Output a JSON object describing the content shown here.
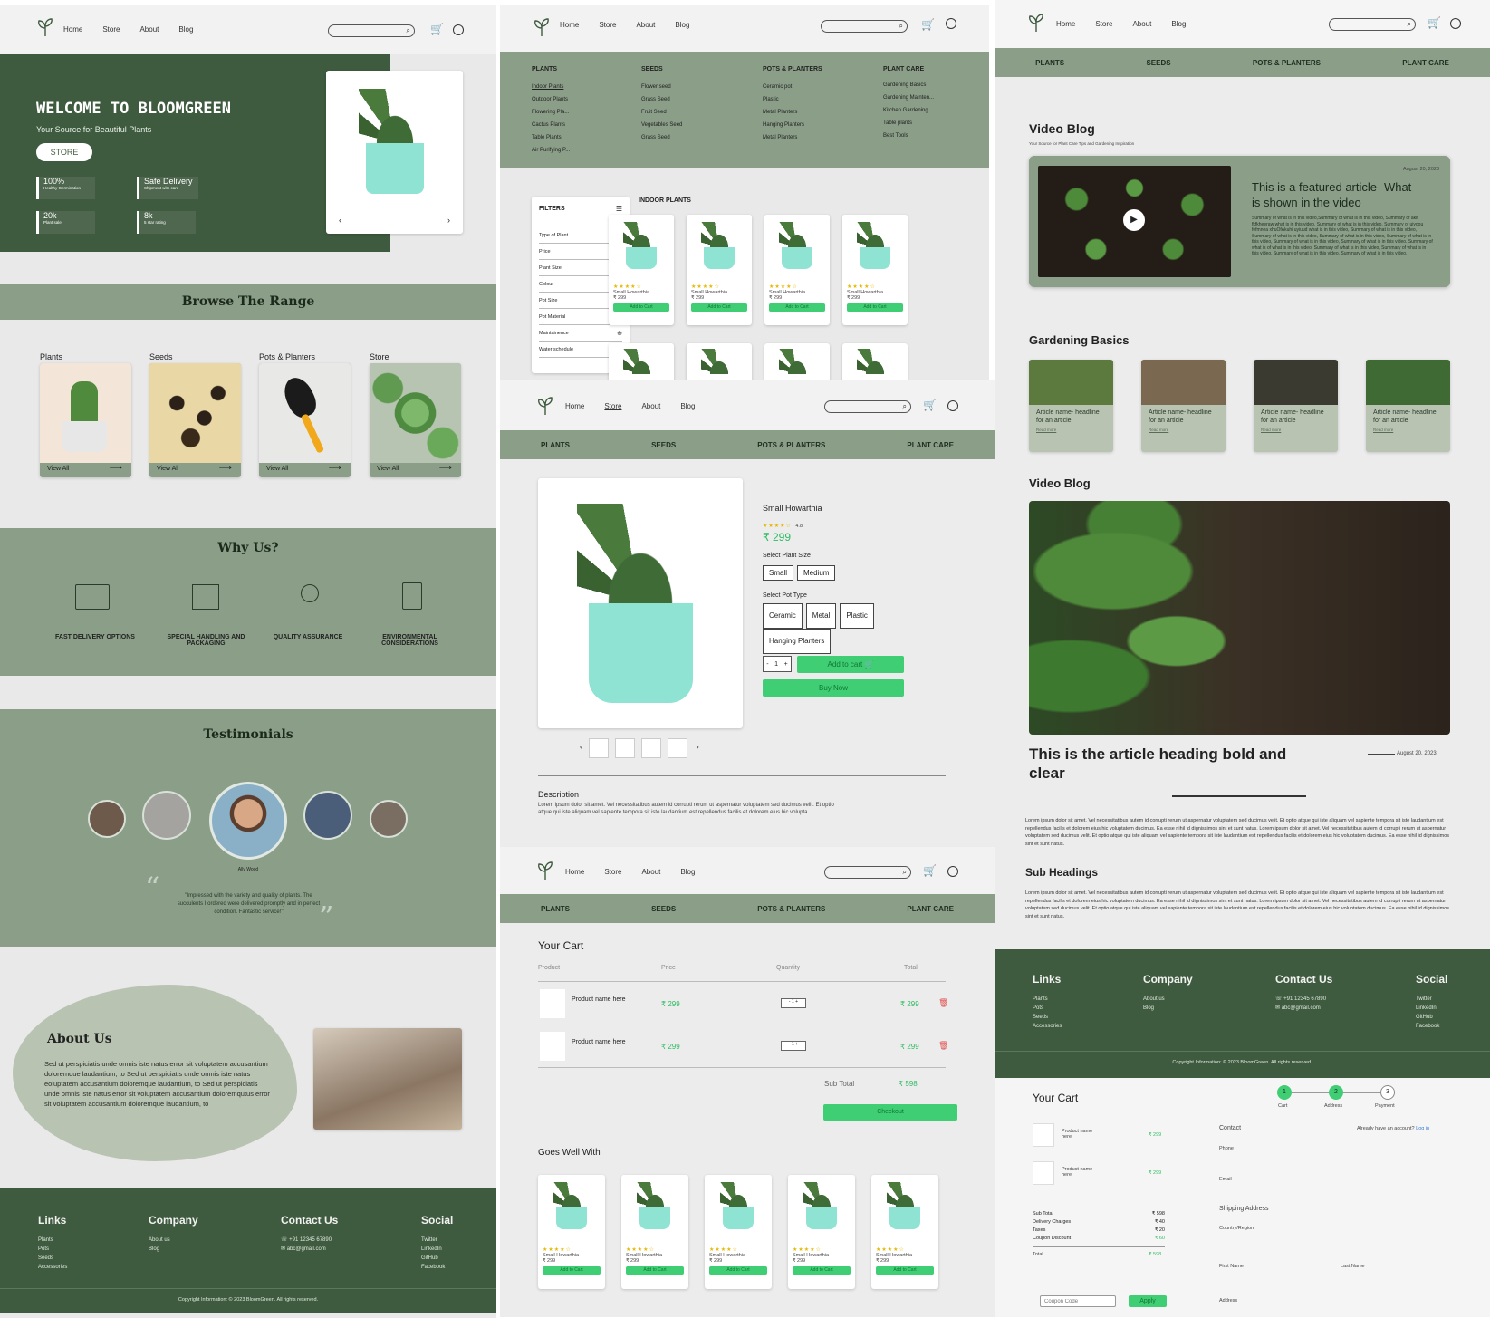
{
  "nav": {
    "home": "Home",
    "store": "Store",
    "about": "About",
    "blog": "Blog"
  },
  "categories": [
    "PLANTS",
    "SEEDS",
    "POTS & PLANTERS",
    "PLANT CARE"
  ],
  "home": {
    "hero_title": "WELCOME TO BLOOMGREEN",
    "hero_subtitle": "Your Source for Beautiful Plants",
    "store_button": "STORE",
    "stats": [
      {
        "value": "100%",
        "label": "Healthy Germination"
      },
      {
        "value": "Safe Delivery",
        "label": "Shipment with care"
      },
      {
        "value": "20k",
        "label": "Plant sale"
      },
      {
        "value": "8k",
        "label": "5 star rating"
      }
    ],
    "browse_title": "Browse The Range",
    "browse_items": [
      {
        "label": "Plants",
        "cta": "View All"
      },
      {
        "label": "Seeds",
        "cta": "View All"
      },
      {
        "label": "Pots & Planters",
        "cta": "View All"
      },
      {
        "label": "Store",
        "cta": "View All"
      }
    ],
    "why_title": "Why Us?",
    "why_items": [
      "FAST DELIVERY OPTIONS",
      "SPECIAL HANDLING AND PACKAGING",
      "QUALITY ASSURANCE",
      "ENVIRONMENTAL CONSIDERATIONS"
    ],
    "testimonials_title": "Testimonials",
    "testimonial_name": "Ally Wood",
    "testimonial_quote": "\"Impressed with the variety and quality of plants. The succulents I ordered were delivered promptly and in perfect condition. Fantastic service!\"",
    "about_title": "About Us",
    "about_text": "Sed ut perspiciatis unde omnis iste natus error sit voluptatem accusantium doloremque laudantium, to Sed ut perspiciatis unde omnis iste natus eoluptatem accusantium doloremque laudantium, to Sed ut perspiciatis unde omnis iste natus error sit voluptatem accusantium doloremqutus error sit voluptatem accusantium doloremque laudantium, to"
  },
  "footer": {
    "links_title": "Links",
    "links": [
      "Plants",
      "Pots",
      "Seeds",
      "Accessories"
    ],
    "company_title": "Company",
    "company": [
      "About us",
      "Blog"
    ],
    "contact_title": "Contact Us",
    "phone": "+91 12345 67890",
    "email": "abc@gmail.com",
    "social_title": "Social",
    "social": [
      "Twitter",
      "LinkedIn",
      "GitHub",
      "Facebook"
    ],
    "copyright": "Copyright Information: © 2023 BloomGreen. All rights reserved."
  },
  "megamenu": {
    "plants": [
      "Indoor Plants",
      "Outdoor Plants",
      "Flowering Pla...",
      "Cactus Plants",
      "Table Plants",
      "Air Purifying P..."
    ],
    "seeds": [
      "Flower seed",
      "Grass Seed",
      "Fruit Seed",
      "Vegetables Seed",
      "Grass Seed"
    ],
    "pots": [
      "Ceramic pot",
      "Plastic",
      "Metal Planters",
      "Hanging Planters",
      "Metal Planters"
    ],
    "care": [
      "Gardening Basics",
      "Gardening Mainten...",
      "Kitchen Gardening",
      "Table plants",
      "Best Tools"
    ]
  },
  "store": {
    "filters_title": "FILTERS",
    "filters": [
      "Type of Plant",
      "Price",
      "Plant Size",
      "Colour",
      "Pot Size",
      "Pot Material",
      "Maintainence",
      "Water schedule"
    ],
    "section_title": "INDOOR PLANTS",
    "product_name": "Small Howarthia",
    "product_price": "₹ 299",
    "add_to_cart": "Add to Cart"
  },
  "product": {
    "name": "Small Howarthia",
    "rating": "4.8",
    "price": "₹ 299",
    "size_label": "Select Plant Size",
    "sizes": [
      "Small",
      "Medium"
    ],
    "pot_label": "Select Pot Type",
    "pots": [
      "Ceramic",
      "Metal",
      "Plastic",
      "Hanging Planters"
    ],
    "qty": "1",
    "add_to_cart": "Add to cart",
    "buy_now": "Buy Now",
    "desc_title": "Description",
    "desc_text": "Lorem ipsum dolor sit amet. Vel necessitatibus autem id corrupti rerum ut aspernatur voluptatem sed ducimus velit. Et optio atque qui iste aliquam vel sapiente tempora sit iste laudantium est repellendus facilis et dolorem eius hic volupta"
  },
  "cart": {
    "title": "Your Cart",
    "headers": [
      "Product",
      "Price",
      "Quantity",
      "Total"
    ],
    "rows": [
      {
        "name": "Product name here",
        "price": "₹ 299",
        "qty": "1",
        "total": "₹ 299"
      },
      {
        "name": "Product name here",
        "price": "₹ 299",
        "qty": "1",
        "total": "₹ 299"
      }
    ],
    "subtotal_label": "Sub Total",
    "subtotal": "₹ 598",
    "checkout": "Checkout",
    "goes_well": "Goes Well With"
  },
  "blog": {
    "video_title": "Video Blog",
    "video_sub": "Your Source for Plant Care Tips and Gardening Inspiration",
    "featured_date": "August 20, 2023",
    "featured_title": "This is a featured article- What is shown in the video",
    "featured_text": "Summary of what is in this video,Summary of what is in this video, Summary of aklt fkfkheeraw what is in this video. Summary of what is in this video, Summary of uiyoou fefmnea xhuOfAkuhi uyiuud what is in this video, Summary of what is in this video, Summary of what is in this video, Summary of what is in this video, Summary of what is in this video, Summary of what is in this video, Summary of what is in this video. Summary of what is of what is in this video, Summary of what is in this video, Summary of what is in this video, Summary of what is in this video, Summary of what is in this video.",
    "basics_title": "Gardening Basics",
    "article_card": "Article name- headline for an article",
    "read_more": "Read more",
    "video_title2": "Video Blog",
    "article_heading": "This is the article heading bold and clear",
    "article_date": "August 20, 2023",
    "article_text": "Lorem ipsum dolor sit amet. Vel necessitatibus autem id corrupti rerum ut aspernatur voluptatem sed ducimus velit. Et optio atque qui iste aliquam vel sapiente tempora sit iste laudantium est repellendus facilis et dolorem eius hic voluptatem ducimus. Ea esse nihil id dignissimos sint et sunt natus. Lorem ipsum dolor sit amet. Vel necessitatibus autem id corrupti rerum ut aspernatur voluptatem sed ducimus velit. Et optio atque qui iste aliquam vel sapiente tempora sit iste laudantium est repellendus facilis et dolorem eius hic voluptatem ducimus. Ea esse nihil id dignissimos sint et sunt natus.",
    "sub_heading": "Sub Headings"
  },
  "checkout": {
    "title": "Your Cart",
    "steps": [
      {
        "n": "1",
        "label": "Cart"
      },
      {
        "n": "2",
        "label": "Address"
      },
      {
        "n": "3",
        "label": "Payment"
      }
    ],
    "items": [
      {
        "name": "Product name here",
        "price": "₹ 299"
      },
      {
        "name": "Product name here",
        "price": "₹ 299"
      }
    ],
    "summary": [
      {
        "label": "Sub Total",
        "value": "₹ 598"
      },
      {
        "label": "Delivery Charges",
        "value": "₹ 40"
      },
      {
        "label": "Taxes",
        "value": "₹ 20"
      },
      {
        "label": "Coupon Discount",
        "value": "₹ 60"
      }
    ],
    "total_label": "Total",
    "total": "₹ 598",
    "coupon_placeholder": "Coupon Code",
    "apply": "Apply",
    "contact_label": "Contact",
    "login_prompt": "Already have an account?",
    "login_link": "Log in",
    "phone_label": "Phone",
    "email_label": "Email",
    "shipping_label": "Shipping Address",
    "country_label": "Country/Region",
    "first_name": "First Name",
    "last_name": "Last Name",
    "address_label": "Address"
  }
}
